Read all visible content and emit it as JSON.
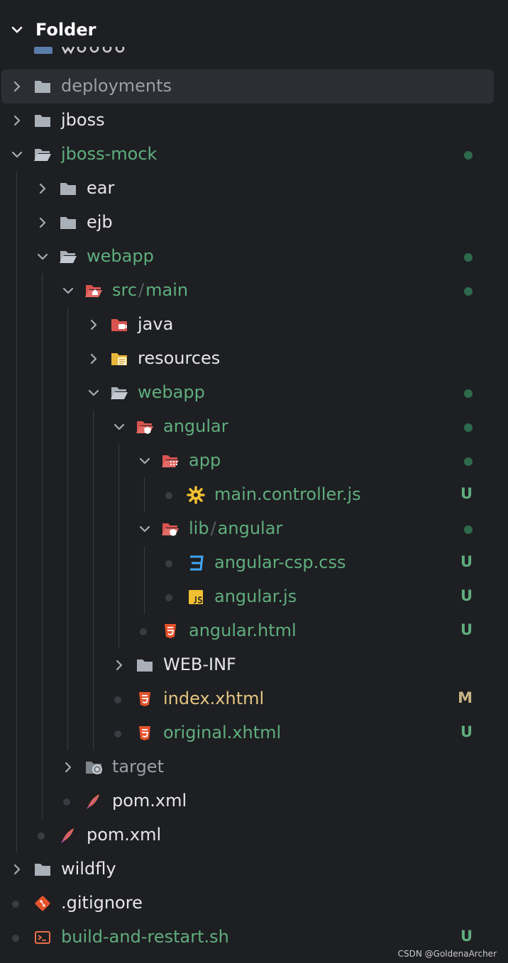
{
  "panel": {
    "title": "Folder"
  },
  "items": [
    {
      "label": "deployments",
      "color": "gray",
      "status": "",
      "selected": true
    },
    {
      "label": "jboss",
      "color": "white",
      "status": ""
    },
    {
      "label": "jboss-mock",
      "color": "green",
      "status": "dot"
    },
    {
      "label": "ear",
      "color": "white",
      "status": ""
    },
    {
      "label": "ejb",
      "color": "white",
      "status": ""
    },
    {
      "label": "webapp",
      "color": "green",
      "status": "dot"
    },
    {
      "label_a": "src",
      "label_b": "main",
      "color": "green",
      "status": "dot"
    },
    {
      "label": "java",
      "color": "white",
      "status": ""
    },
    {
      "label": "resources",
      "color": "white",
      "status": ""
    },
    {
      "label": "webapp",
      "color": "green",
      "status": "dot"
    },
    {
      "label": "angular",
      "color": "green",
      "status": "dot"
    },
    {
      "label": "app",
      "color": "green",
      "status": "dot"
    },
    {
      "label": "main.controller.js",
      "color": "green",
      "status": "U"
    },
    {
      "label_a": "lib",
      "label_b": "angular",
      "color": "green",
      "status": "dot"
    },
    {
      "label": "angular-csp.css",
      "color": "green",
      "status": "U"
    },
    {
      "label": "angular.js",
      "color": "green",
      "status": "U"
    },
    {
      "label": "angular.html",
      "color": "green",
      "status": "U"
    },
    {
      "label": "WEB-INF",
      "color": "white",
      "status": ""
    },
    {
      "label": "index.xhtml",
      "color": "yellow",
      "status": "M"
    },
    {
      "label": "original.xhtml",
      "color": "green",
      "status": "U"
    },
    {
      "label": "target",
      "color": "gray",
      "status": ""
    },
    {
      "label": "pom.xml",
      "color": "white",
      "status": ""
    },
    {
      "label": "pom.xml",
      "color": "white",
      "status": ""
    },
    {
      "label": "wildfly",
      "color": "white",
      "status": ""
    },
    {
      "label": ".gitignore",
      "color": "white",
      "status": ""
    },
    {
      "label": "build-and-restart.sh",
      "color": "green",
      "status": "U"
    }
  ],
  "status_markers": {
    "untracked": "U",
    "modified": "M"
  },
  "colors": {
    "background": "#1e1f22",
    "selected_row": "#2c2e33",
    "untracked_text": "#5fae7e",
    "modified_text": "#e4c583",
    "status_dot": "#2d6a4b",
    "u_badge": "#5fae7e",
    "m_badge": "#c9b585"
  },
  "icons": {
    "folder": "folder-icon",
    "folder_open": "folder-open-icon",
    "html": "html5-icon",
    "css": "css-icon",
    "js": "javascript-icon",
    "gear": "gear-icon",
    "maven": "maven-feather-icon",
    "git": "git-icon",
    "terminal": "terminal-icon"
  },
  "watermark": "CSDN @GoldenaArcher"
}
